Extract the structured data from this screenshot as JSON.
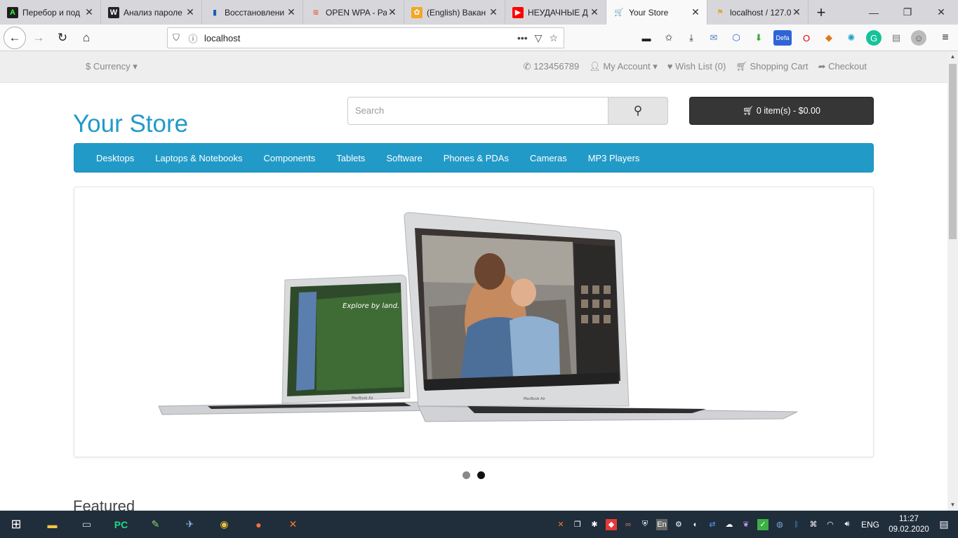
{
  "browser": {
    "tabs": [
      {
        "title": "Перебор и под",
        "favicon": "A",
        "fav_color": "#1e1e1e",
        "fav_text": "#32ff32"
      },
      {
        "title": "Анализ пароле",
        "favicon": "W",
        "fav_color": "#222222",
        "fav_text": "#ffffff"
      },
      {
        "title": "Восстановлени",
        "favicon": "▮",
        "fav_color": "transparent",
        "fav_text": "#1a5fbf"
      },
      {
        "title": "OPEN WPA - Ра",
        "favicon": "≋",
        "fav_color": "transparent",
        "fav_text": "#e8614d"
      },
      {
        "title": "(English) Вакан",
        "favicon": "✿",
        "fav_color": "#f5a623",
        "fav_text": "#ffffff"
      },
      {
        "title": "НЕУДАЧНЫЕ Д",
        "favicon": "▶",
        "fav_color": "#ff0000",
        "fav_text": "#ffffff"
      },
      {
        "title": "Your Store",
        "favicon": "🛒",
        "fav_color": "transparent",
        "fav_text": "#666666",
        "active": true
      },
      {
        "title": "localhost / 127.0",
        "favicon": "⚑",
        "fav_color": "transparent",
        "fav_text": "#e8a33d"
      }
    ],
    "url": "localhost",
    "new_tab": "+",
    "window_controls": [
      "—",
      "❐",
      "✕"
    ]
  },
  "store": {
    "currency": "$ Currency ▾",
    "phone": "123456789",
    "my_account": "My Account ▾",
    "wish_list": "Wish List (0)",
    "shopping_cart": "Shopping Cart",
    "checkout": "Checkout",
    "logo": "Your Store",
    "search_placeholder": "Search",
    "cart_button": "0 item(s) - $0.00",
    "menu": [
      "Desktops",
      "Laptops & Notebooks",
      "Components",
      "Tablets",
      "Software",
      "Phones & PDAs",
      "Cameras",
      "MP3 Players"
    ],
    "slide_caption_left": "Explore by land.",
    "laptop_label": "MacBook Air",
    "featured": "Featured"
  },
  "colors": {
    "brand": "#229ac8",
    "cart_bg": "#363636",
    "taskbar": "#202d3b"
  },
  "taskbar": {
    "lang": "ENG",
    "time": "11:27",
    "date": "09.02.2020"
  }
}
